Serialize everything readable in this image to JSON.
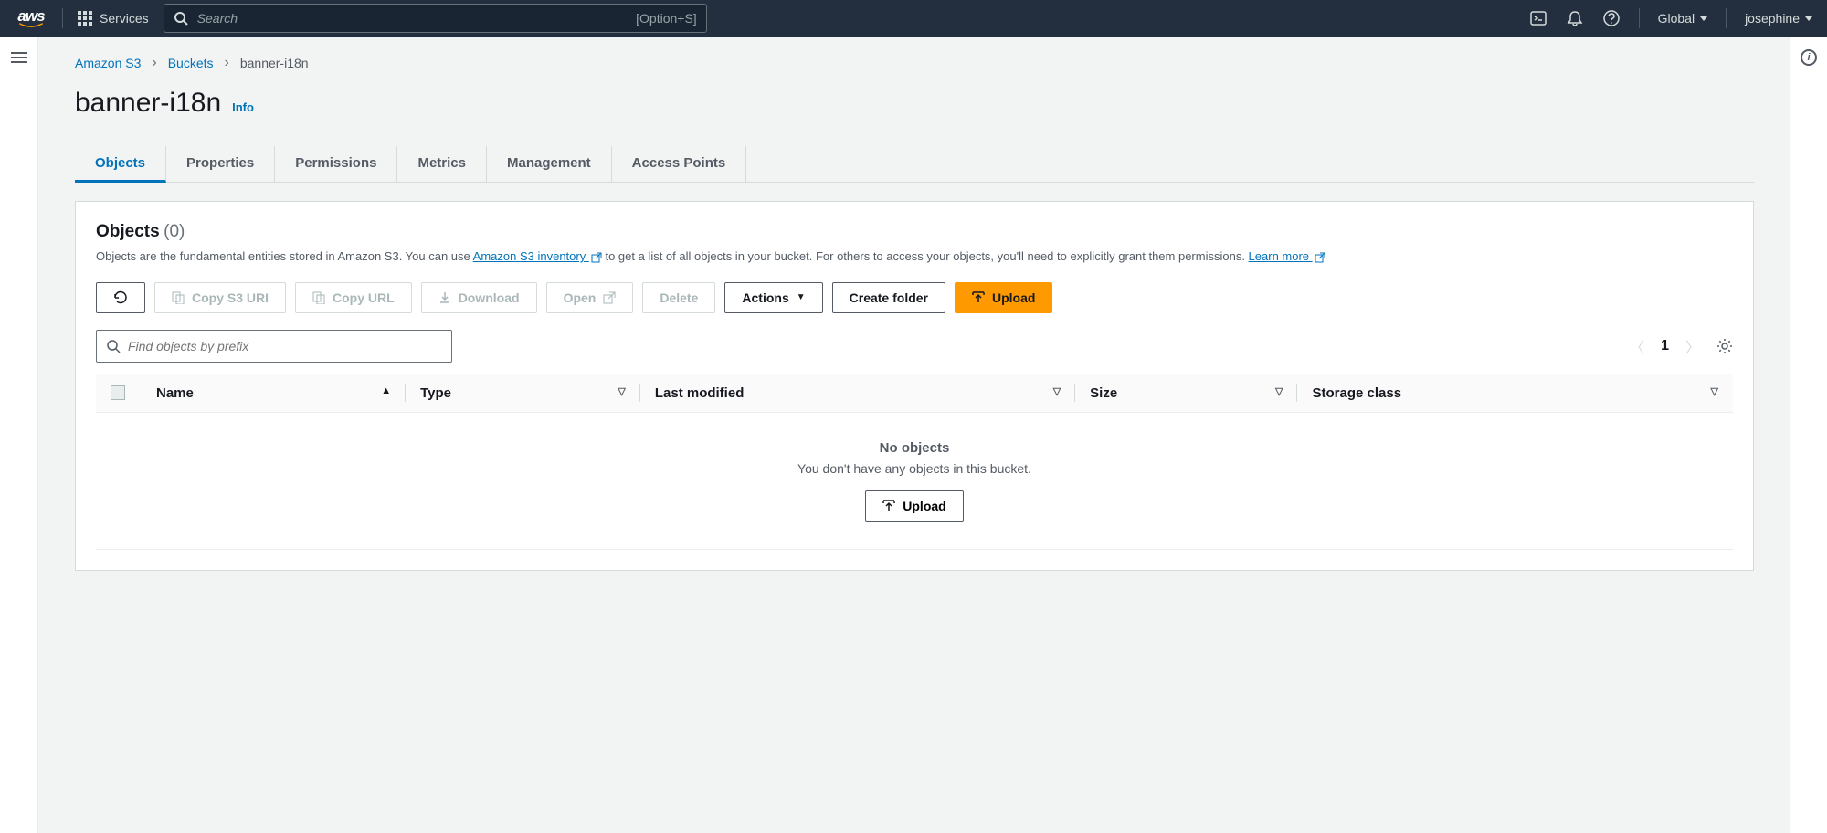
{
  "topbar": {
    "services_label": "Services",
    "search_placeholder": "Search",
    "search_shortcut": "[Option+S]",
    "region": "Global",
    "user": "josephine"
  },
  "breadcrumb": {
    "root": "Amazon S3",
    "buckets": "Buckets",
    "current": "banner-i18n"
  },
  "page": {
    "title": "banner-i18n",
    "info": "Info"
  },
  "tabs": {
    "objects": "Objects",
    "properties": "Properties",
    "permissions": "Permissions",
    "metrics": "Metrics",
    "management": "Management",
    "access_points": "Access Points"
  },
  "panel": {
    "title": "Objects",
    "count": "(0)",
    "desc_prefix": "Objects are the fundamental entities stored in Amazon S3. You can use ",
    "desc_link1": "Amazon S3 inventory ",
    "desc_mid": " to get a list of all objects in your bucket. For others to access your objects, you'll need to explicitly grant them permissions. ",
    "desc_link2": "Learn more "
  },
  "toolbar": {
    "copy_s3_uri": "Copy S3 URI",
    "copy_url": "Copy URL",
    "download": "Download",
    "open": "Open",
    "delete": "Delete",
    "actions": "Actions",
    "create_folder": "Create folder",
    "upload": "Upload"
  },
  "filter": {
    "placeholder": "Find objects by prefix"
  },
  "pagination": {
    "page": "1"
  },
  "columns": {
    "name": "Name",
    "type": "Type",
    "last_modified": "Last modified",
    "size": "Size",
    "storage_class": "Storage class"
  },
  "empty": {
    "title": "No objects",
    "sub": "You don't have any objects in this bucket.",
    "upload": "Upload"
  }
}
